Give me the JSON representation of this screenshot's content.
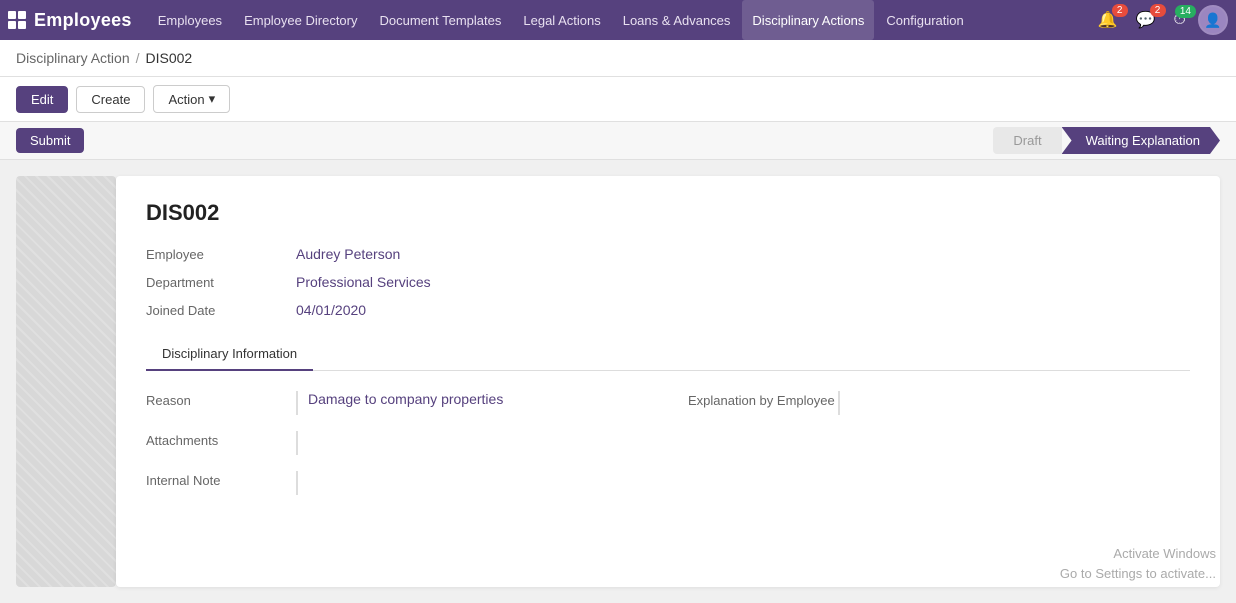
{
  "app": {
    "name": "Employees",
    "grid_icon": true
  },
  "nav": {
    "items": [
      {
        "id": "employees",
        "label": "Employees",
        "active": false
      },
      {
        "id": "employee-directory",
        "label": "Employee Directory",
        "active": false
      },
      {
        "id": "document-templates",
        "label": "Document Templates",
        "active": false
      },
      {
        "id": "legal-actions",
        "label": "Legal Actions",
        "active": false
      },
      {
        "id": "loans-advances",
        "label": "Loans & Advances",
        "active": false
      },
      {
        "id": "disciplinary-actions",
        "label": "Disciplinary Actions",
        "active": true
      },
      {
        "id": "configuration",
        "label": "Configuration",
        "active": false
      }
    ]
  },
  "topbar_right": {
    "bell_badge": "2",
    "chat_badge": "2",
    "clock_badge": "14"
  },
  "breadcrumb": {
    "parent": "Disciplinary Action",
    "separator": "/",
    "current": "DIS002"
  },
  "toolbar": {
    "edit_label": "Edit",
    "create_label": "Create",
    "action_label": "Action",
    "chevron": "▾"
  },
  "status_bar": {
    "submit_label": "Submit",
    "steps": [
      {
        "id": "draft",
        "label": "Draft",
        "active": false
      },
      {
        "id": "waiting-explanation",
        "label": "Waiting Explanation",
        "active": true
      }
    ]
  },
  "record": {
    "id": "DIS002",
    "fields": {
      "employee_label": "Employee",
      "employee_value": "Audrey Peterson",
      "department_label": "Department",
      "department_value": "Professional Services",
      "joined_date_label": "Joined Date",
      "joined_date_value": "04/01/2020"
    }
  },
  "tabs": [
    {
      "id": "disciplinary-info",
      "label": "Disciplinary Information",
      "active": true
    }
  ],
  "tab_content": {
    "reason_label": "Reason",
    "reason_value": "Damage to company properties",
    "explanation_label": "Explanation by Employee",
    "explanation_value": "",
    "attachments_label": "Attachments",
    "attachments_value": "",
    "internal_note_label": "Internal Note",
    "internal_note_value": ""
  },
  "watermark": {
    "line1": "Activate Windows",
    "line2": "Go to Settings to activate..."
  }
}
